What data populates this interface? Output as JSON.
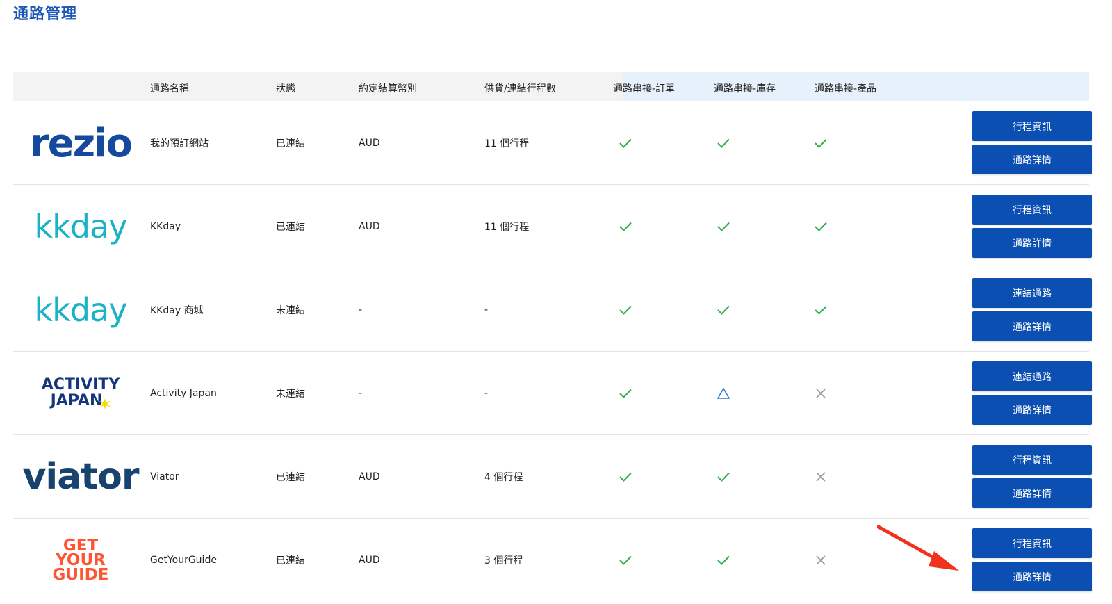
{
  "page": {
    "title": "通路管理"
  },
  "table": {
    "headers": {
      "name": "通路名稱",
      "status": "狀態",
      "currency": "約定結算幣別",
      "count": "供貨/連結行程數",
      "sync_order": "通路串接-訂單",
      "sync_inventory": "通路串接-庫存",
      "sync_product": "通路串接-產品"
    },
    "rows": [
      {
        "logo": {
          "text": "rezio",
          "icon": "rezio-logo"
        },
        "name": "我的預訂網站",
        "status": "已連結",
        "status_color": "#3fae4c",
        "currency": "AUD",
        "count": "11 個行程",
        "sync": [
          "check",
          "check",
          "check"
        ],
        "buttons": [
          "行程資訊",
          "通路詳情"
        ]
      },
      {
        "logo": {
          "text": "kkday",
          "icon": "kkday-logo"
        },
        "name": "KKday",
        "status": "已連結",
        "status_color": "#3fae4c",
        "currency": "AUD",
        "count": "11 個行程",
        "sync": [
          "check",
          "check",
          "check"
        ],
        "buttons": [
          "行程資訊",
          "通路詳情"
        ]
      },
      {
        "logo": {
          "text": "kkday",
          "icon": "kkday-logo"
        },
        "name": "KKday 商城",
        "status": "未連結",
        "status_color": "#d9343a",
        "currency": "-",
        "count": "-",
        "sync": [
          "check",
          "check",
          "check"
        ],
        "buttons": [
          "連結通路",
          "通路詳情"
        ]
      },
      {
        "logo": {
          "text_line1": "ACTIVITY",
          "text_line2": "JAPAN",
          "icon": "activity-japan-logo"
        },
        "name": "Activity Japan",
        "status": "未連結",
        "status_color": "#d9343a",
        "currency": "-",
        "count": "-",
        "sync": [
          "check",
          "triangle",
          "cross"
        ],
        "buttons": [
          "連結通路",
          "通路詳情"
        ]
      },
      {
        "logo": {
          "text": "viator",
          "icon": "viator-logo"
        },
        "name": "Viator",
        "status": "已連結",
        "status_color": "#3fae4c",
        "currency": "AUD",
        "count": "4 個行程",
        "sync": [
          "check",
          "check",
          "cross"
        ],
        "buttons": [
          "行程資訊",
          "通路詳情"
        ]
      },
      {
        "logo": {
          "text_line1": "GET",
          "text_line2": "YOUR",
          "text_line3": "GUIDE",
          "icon": "getyourguide-logo"
        },
        "name": "GetYourGuide",
        "status": "已連結",
        "status_color": "#3fae4c",
        "currency": "AUD",
        "count": "3 個行程",
        "sync": [
          "check",
          "check",
          "cross"
        ],
        "buttons": [
          "行程資訊",
          "通路詳情"
        ]
      }
    ]
  },
  "colors": {
    "accent": "#0b4fb3",
    "title": "#1a56b8",
    "check": "#2fae4a",
    "triangle": "#2a7bd0",
    "cross": "#9a9a9a",
    "annotation_arrow": "#f0321e"
  }
}
